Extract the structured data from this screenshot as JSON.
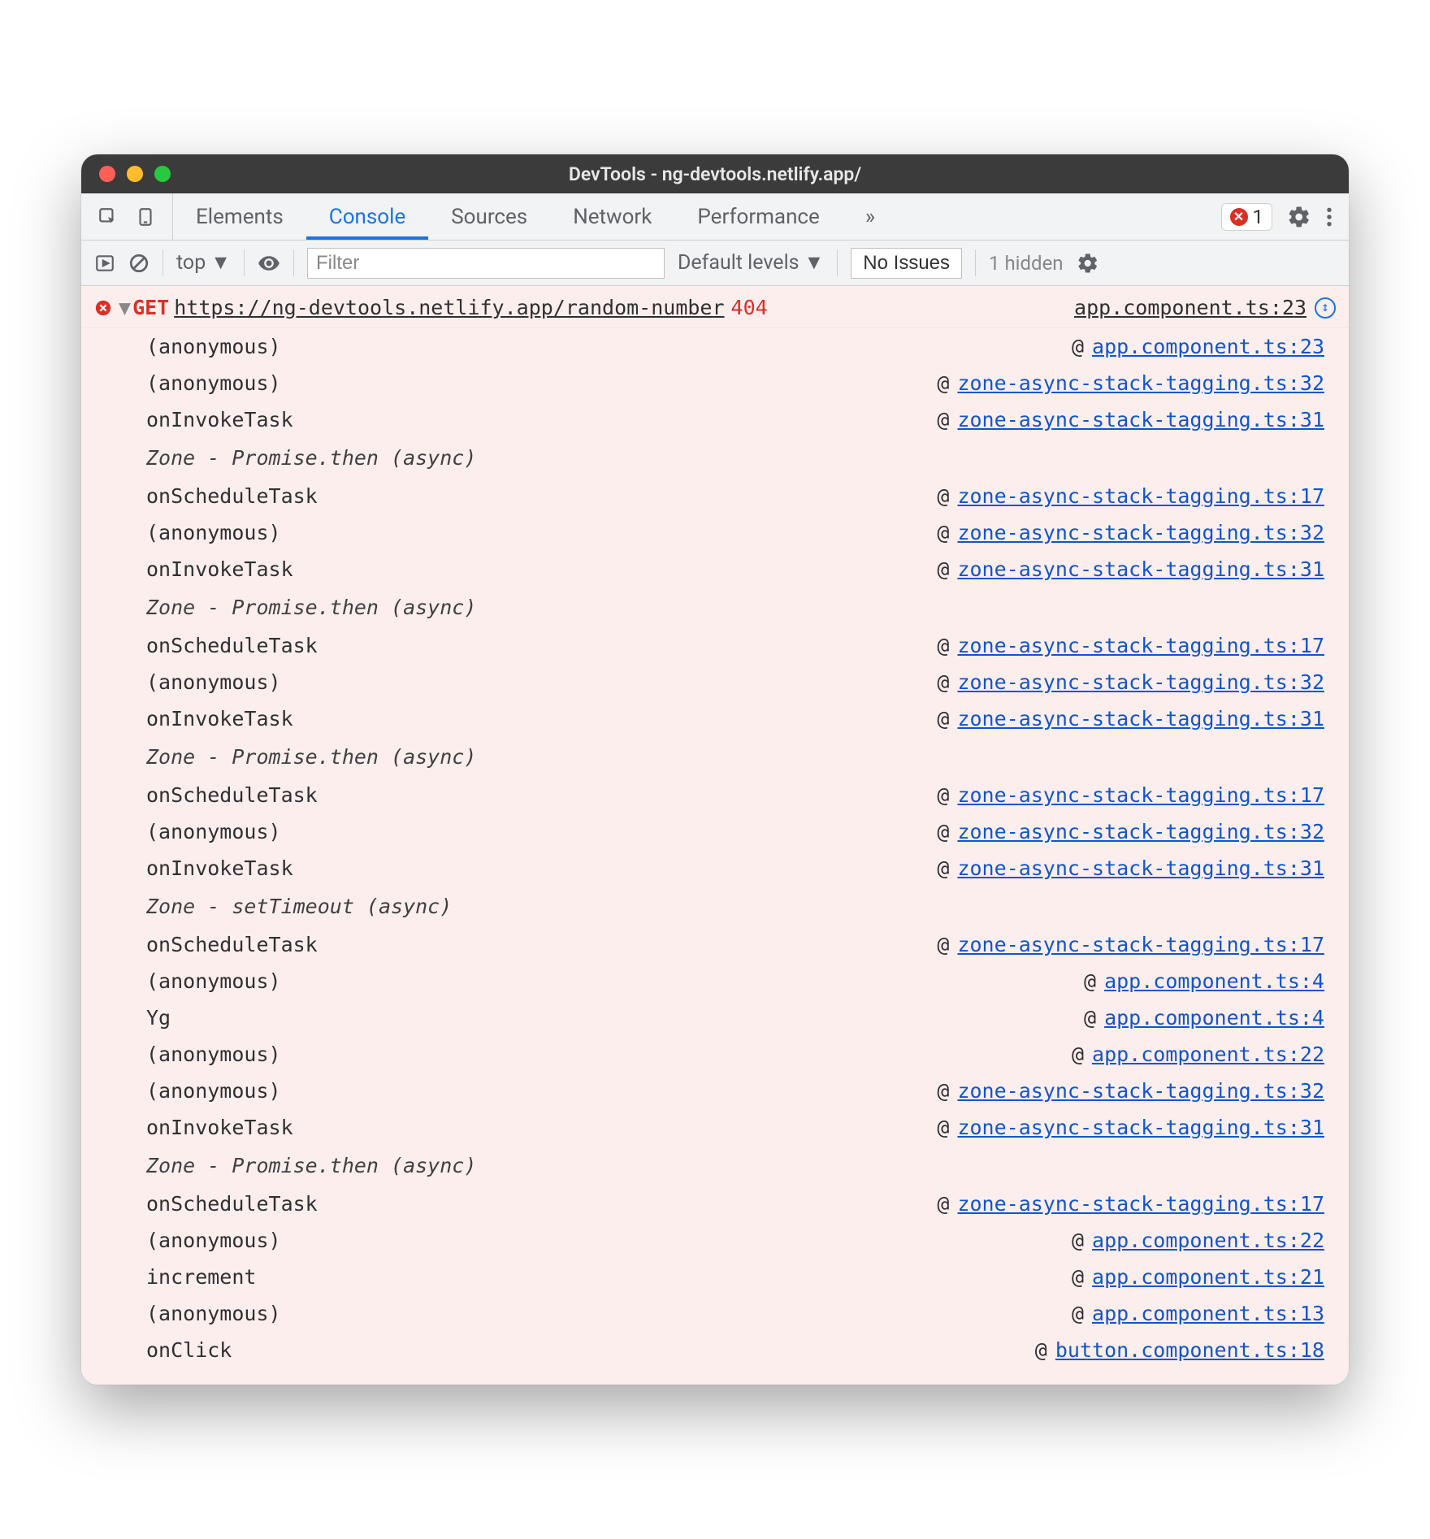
{
  "titlebar": {
    "title": "DevTools - ng-devtools.netlify.app/"
  },
  "tabs": {
    "elements": "Elements",
    "console": "Console",
    "sources": "Sources",
    "network": "Network",
    "performance": "Performance",
    "more": "»",
    "error_count": "1"
  },
  "toolbar": {
    "context": "top",
    "filter_placeholder": "Filter",
    "levels": "Default levels",
    "issues_button": "No Issues",
    "hidden": "1 hidden"
  },
  "error": {
    "method": "GET",
    "url": "https://ng-devtools.netlify.app/random-number",
    "status": "404",
    "source_head": "app.component.ts:23"
  },
  "zone_labels": {
    "promise": "Zone - Promise.then (async)",
    "timeout": "Zone - setTimeout (async)"
  },
  "frames": [
    {
      "fn": "(anonymous)",
      "loc": "app.component.ts:23"
    },
    {
      "fn": "(anonymous)",
      "loc": "zone-async-stack-tagging.ts:32"
    },
    {
      "fn": "onInvokeTask",
      "loc": "zone-async-stack-tagging.ts:31"
    },
    {
      "zone": "promise"
    },
    {
      "fn": "onScheduleTask",
      "loc": "zone-async-stack-tagging.ts:17"
    },
    {
      "fn": "(anonymous)",
      "loc": "zone-async-stack-tagging.ts:32"
    },
    {
      "fn": "onInvokeTask",
      "loc": "zone-async-stack-tagging.ts:31"
    },
    {
      "zone": "promise"
    },
    {
      "fn": "onScheduleTask",
      "loc": "zone-async-stack-tagging.ts:17"
    },
    {
      "fn": "(anonymous)",
      "loc": "zone-async-stack-tagging.ts:32"
    },
    {
      "fn": "onInvokeTask",
      "loc": "zone-async-stack-tagging.ts:31"
    },
    {
      "zone": "promise"
    },
    {
      "fn": "onScheduleTask",
      "loc": "zone-async-stack-tagging.ts:17"
    },
    {
      "fn": "(anonymous)",
      "loc": "zone-async-stack-tagging.ts:32"
    },
    {
      "fn": "onInvokeTask",
      "loc": "zone-async-stack-tagging.ts:31"
    },
    {
      "zone": "timeout"
    },
    {
      "fn": "onScheduleTask",
      "loc": "zone-async-stack-tagging.ts:17"
    },
    {
      "fn": "(anonymous)",
      "loc": "app.component.ts:4"
    },
    {
      "fn": "Yg",
      "loc": "app.component.ts:4"
    },
    {
      "fn": "(anonymous)",
      "loc": "app.component.ts:22"
    },
    {
      "fn": "(anonymous)",
      "loc": "zone-async-stack-tagging.ts:32"
    },
    {
      "fn": "onInvokeTask",
      "loc": "zone-async-stack-tagging.ts:31"
    },
    {
      "zone": "promise"
    },
    {
      "fn": "onScheduleTask",
      "loc": "zone-async-stack-tagging.ts:17"
    },
    {
      "fn": "(anonymous)",
      "loc": "app.component.ts:22"
    },
    {
      "fn": "increment",
      "loc": "app.component.ts:21"
    },
    {
      "fn": "(anonymous)",
      "loc": "app.component.ts:13"
    },
    {
      "fn": "onClick",
      "loc": "button.component.ts:18"
    }
  ]
}
